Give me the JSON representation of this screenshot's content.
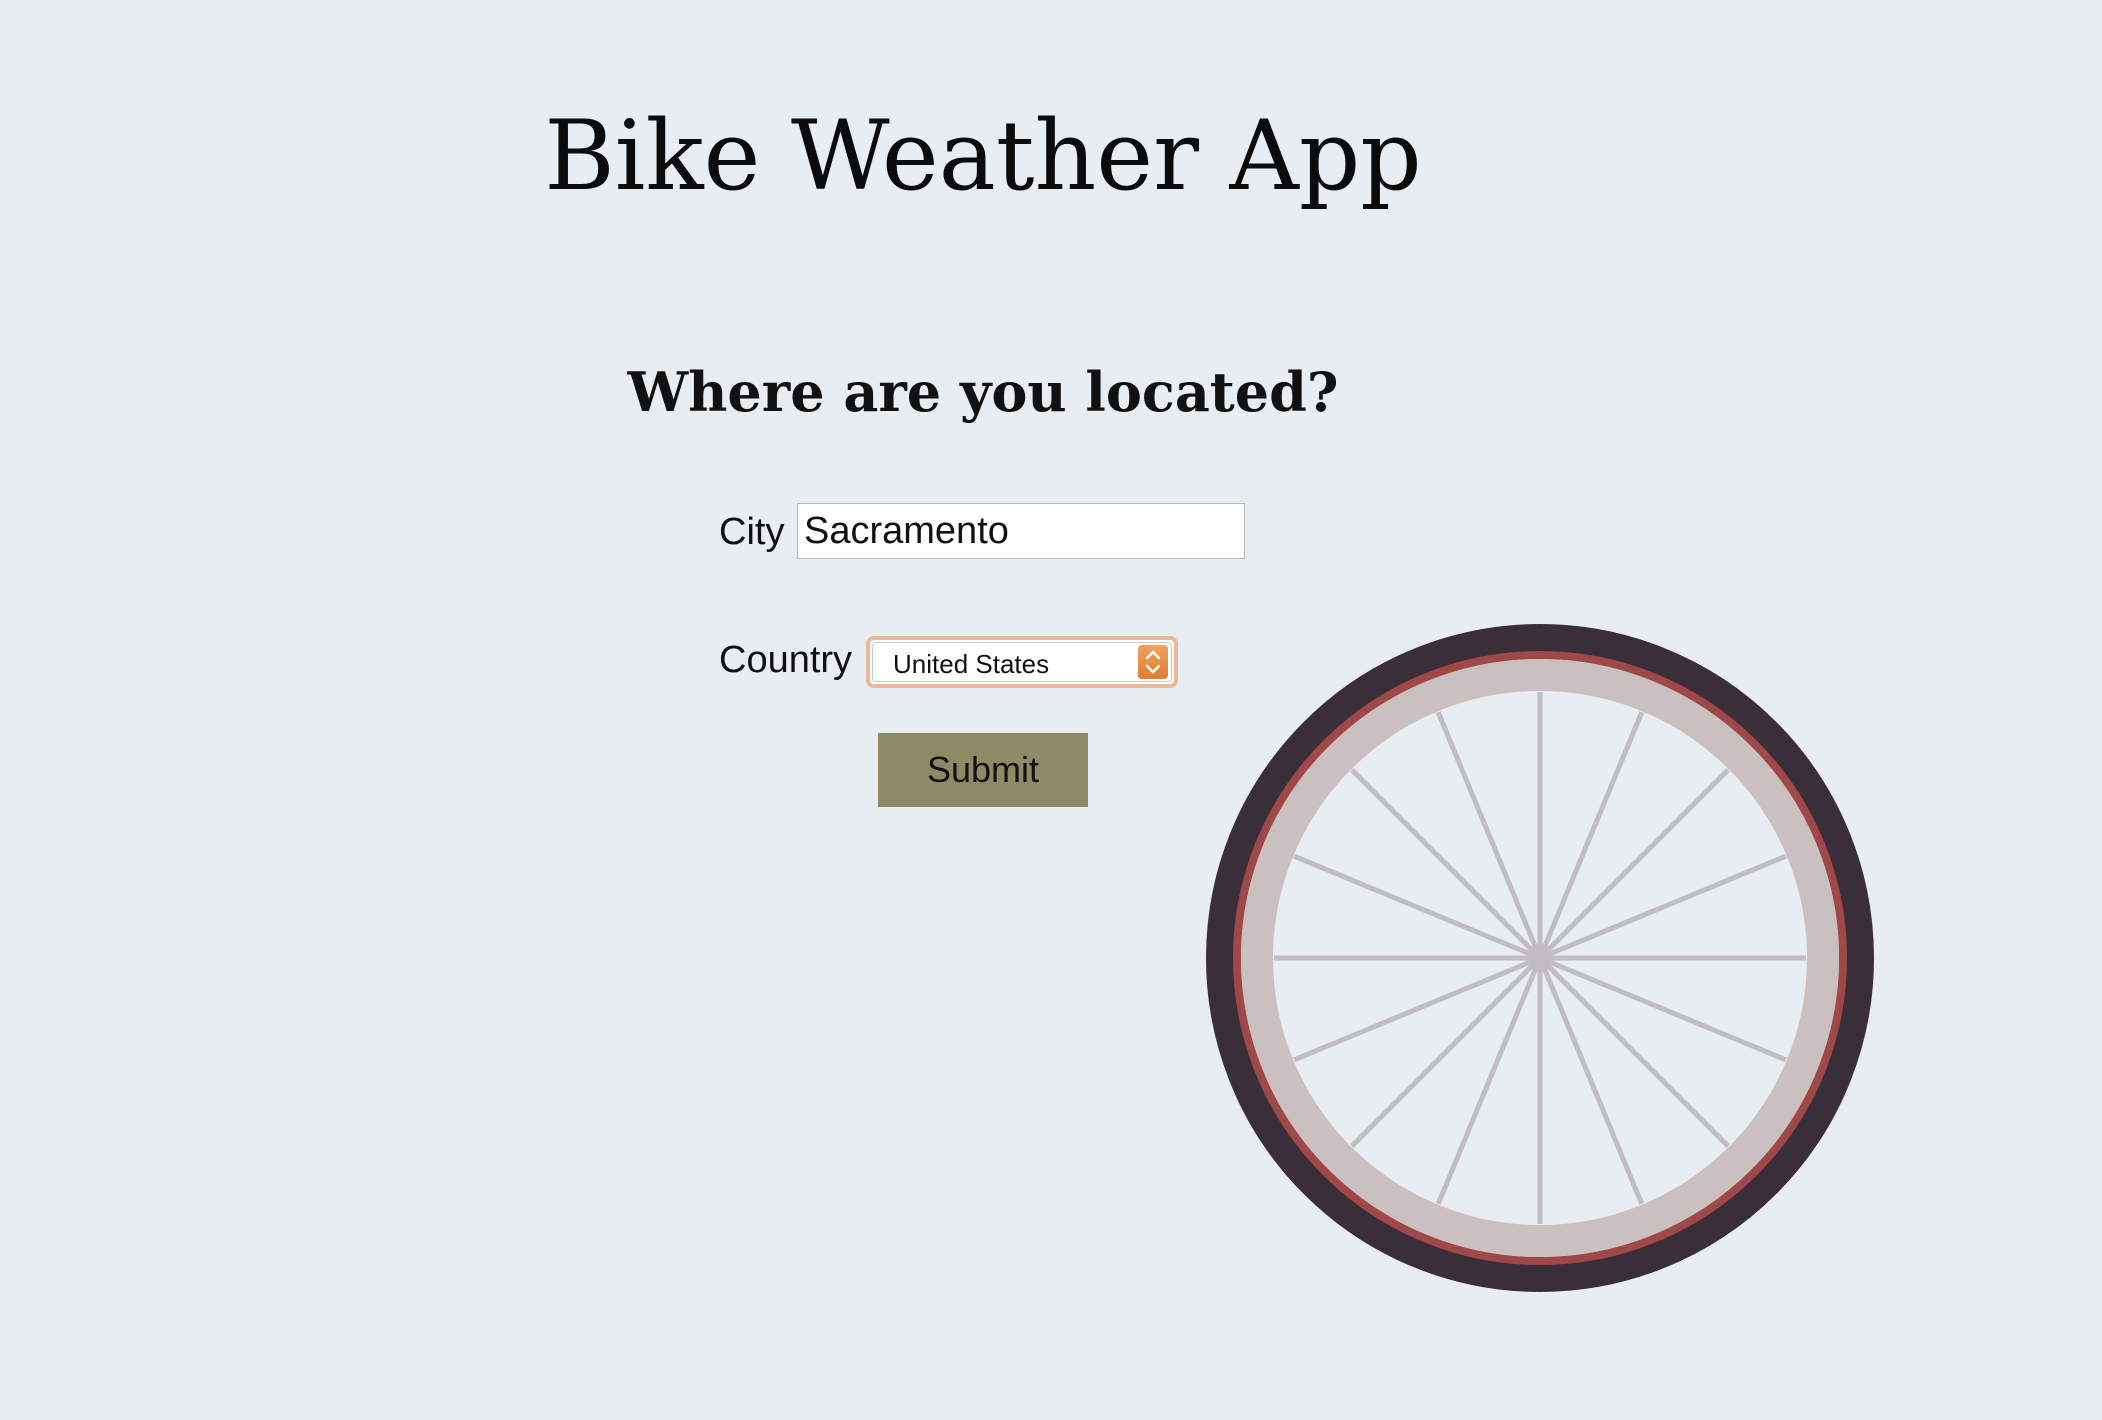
{
  "app": {
    "title": "Bike Weather App",
    "subtitle": "Where are you located?"
  },
  "form": {
    "city": {
      "label": "City",
      "value": "Sacramento"
    },
    "country": {
      "label": "Country",
      "selected": "United States"
    },
    "submit_label": "Submit"
  },
  "decoration": {
    "icon": "bike-wheel-icon",
    "spoke_count": 16,
    "colors": {
      "background": "#e8edf1",
      "tire": "#3a2e39",
      "rim_stripe": "#9e4848",
      "rim": "#cbc0c0",
      "spokes": "#c1bdc1",
      "button": "#8c8b65",
      "select_focus": "#ebb89b"
    }
  }
}
